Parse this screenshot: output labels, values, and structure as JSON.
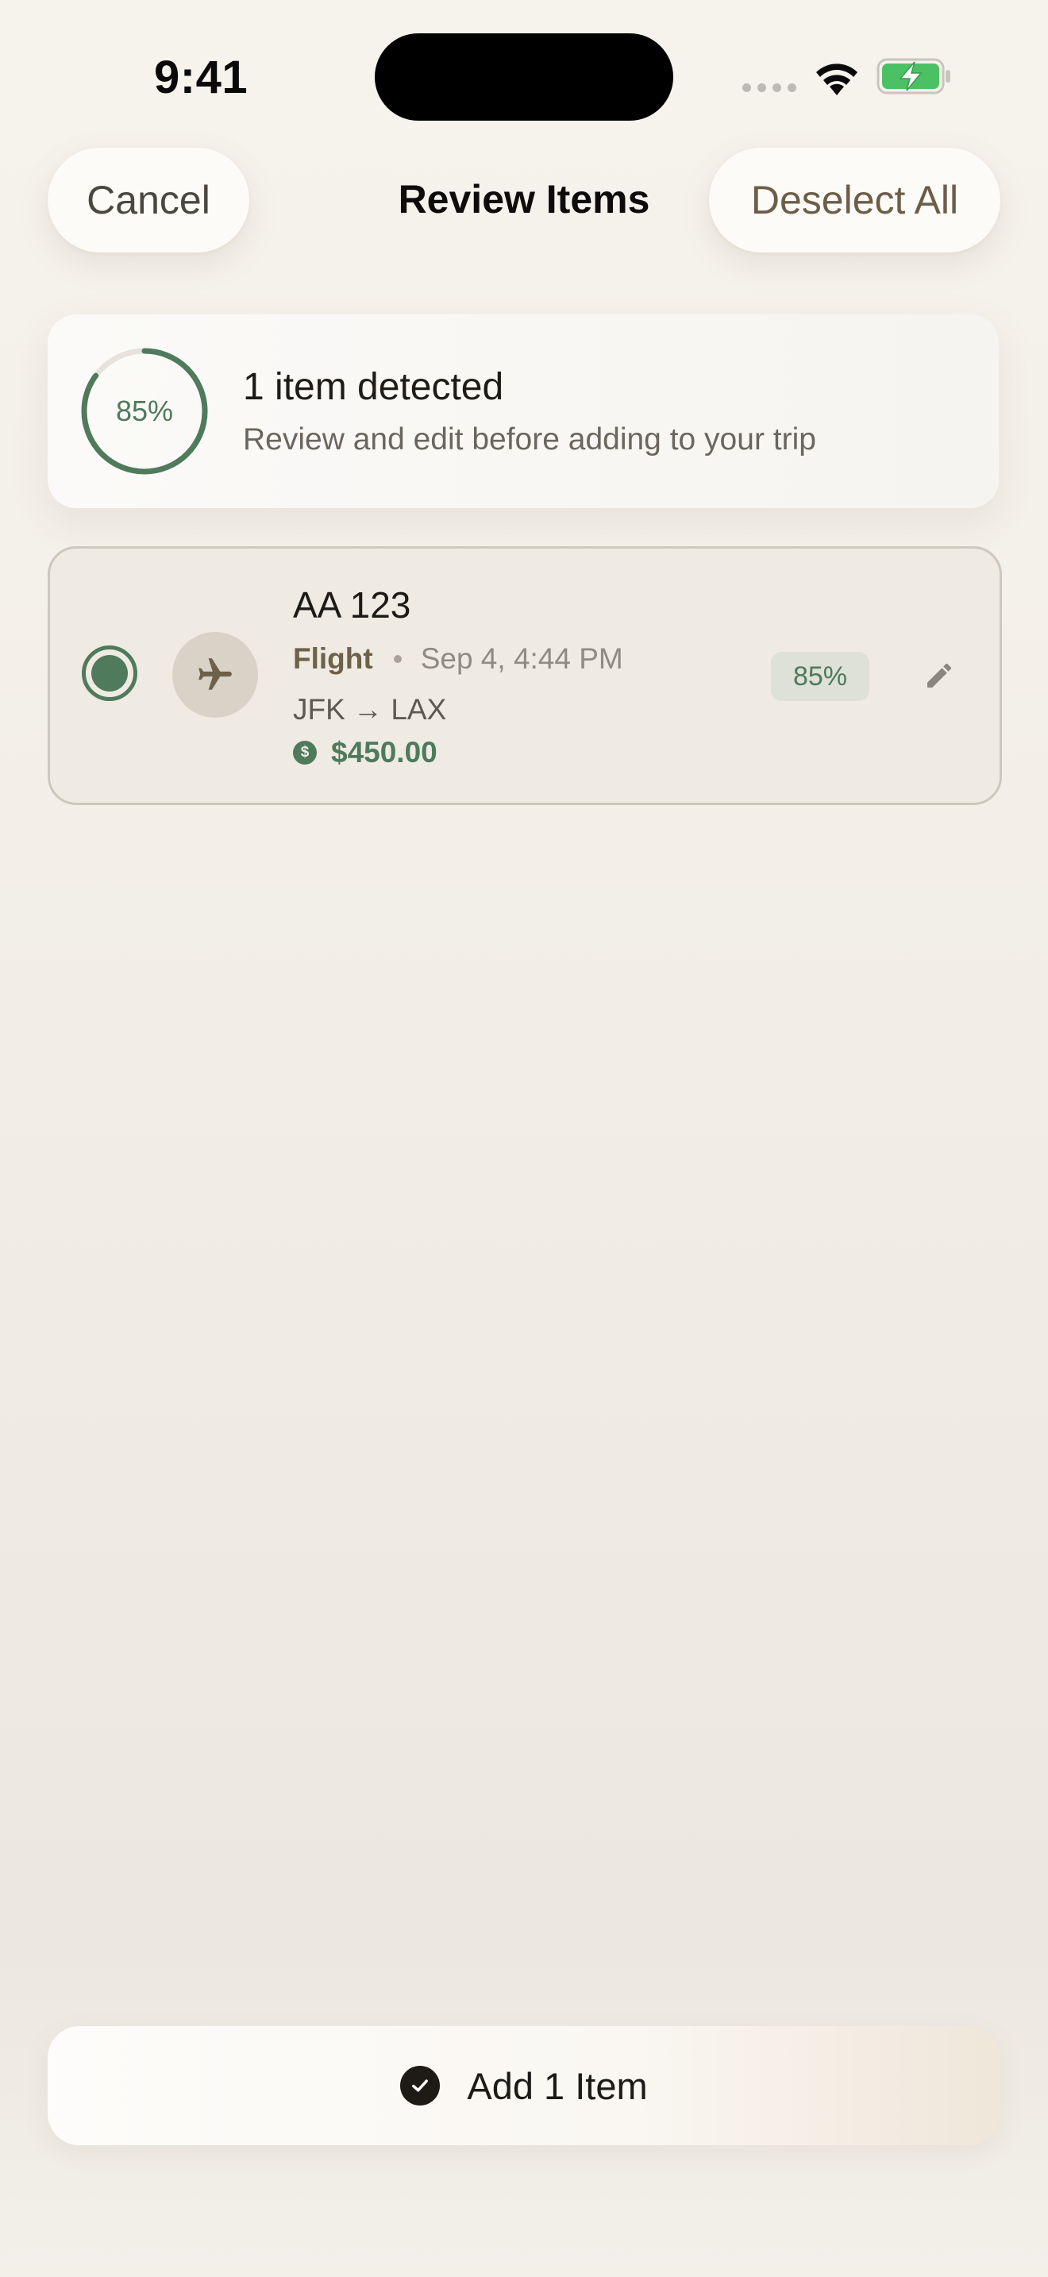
{
  "status_bar": {
    "time": "9:41",
    "battery_color": "#4cc164"
  },
  "nav": {
    "cancel_label": "Cancel",
    "title": "Review Items",
    "deselect_label": "Deselect All"
  },
  "summary": {
    "confidence_percent": 85,
    "confidence_label": "85%",
    "title": "1 item detected",
    "subtitle": "Review and edit before adding to your trip"
  },
  "items": [
    {
      "selected": true,
      "type_icon": "airplane-icon",
      "title": "AA 123",
      "type_label": "Flight",
      "date": "Sep 4, 4:44 PM",
      "route": "JFK → LAX",
      "price": "$450.00",
      "price_icon": "dollar-icon",
      "confidence_label": "85%",
      "edit_icon": "pencil-icon"
    }
  ],
  "footer": {
    "add_label": "Add 1 Item",
    "add_icon": "checkmark-circle-icon"
  },
  "colors": {
    "accent_green": "#4f7a5c",
    "brown_text": "#6e6149",
    "background": "#f3efe8"
  }
}
